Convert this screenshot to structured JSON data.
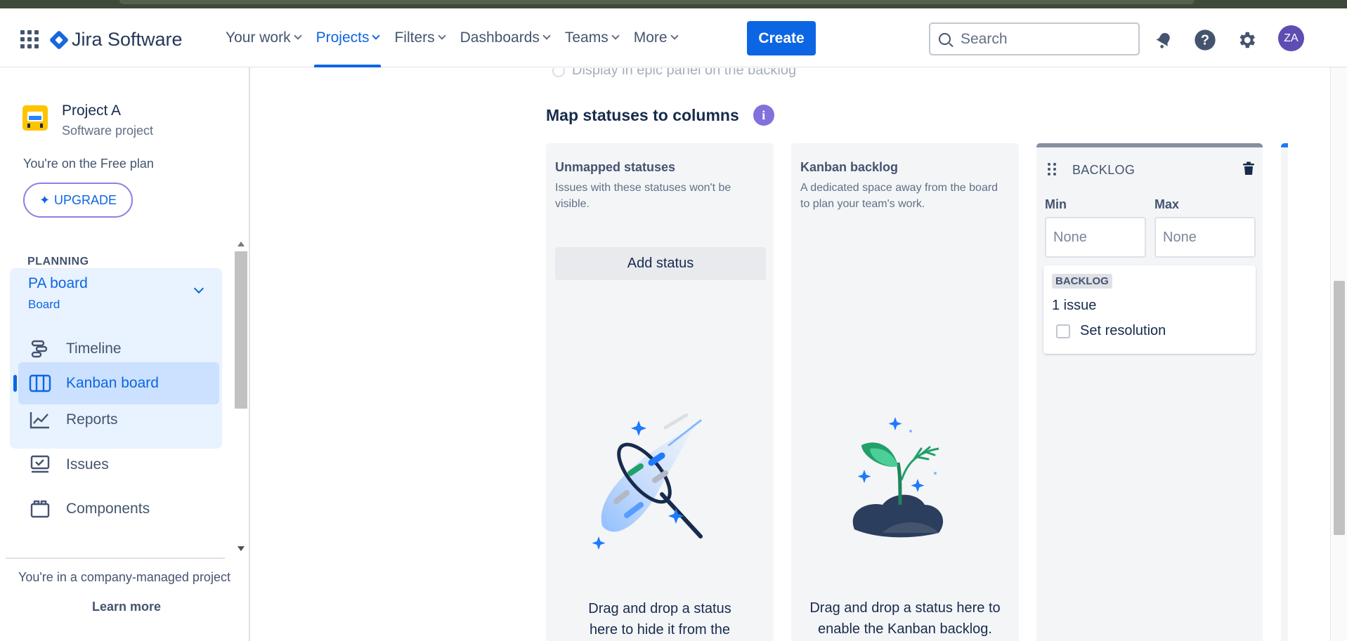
{
  "nav": {
    "brand": "Jira Software",
    "menu": [
      {
        "label": "Your work",
        "active": false
      },
      {
        "label": "Projects",
        "active": true
      },
      {
        "label": "Filters",
        "active": false
      },
      {
        "label": "Dashboards",
        "active": false
      },
      {
        "label": "Teams",
        "active": false
      },
      {
        "label": "More",
        "active": false
      }
    ],
    "create_label": "Create",
    "search_placeholder": "Search",
    "avatar_initials": "ZA",
    "accent_color": "#0c66e4"
  },
  "sidebar": {
    "project_name": "Project A",
    "project_type": "Software project",
    "plan_text": "You're on the Free plan",
    "upgrade_label": "UPGRADE",
    "section_label": "PLANNING",
    "board_name": "PA board",
    "board_sub": "Board",
    "items": [
      {
        "label": "Timeline",
        "icon": "timeline-icon"
      },
      {
        "label": "Kanban board",
        "icon": "kanban-board-icon",
        "selected": true
      },
      {
        "label": "Reports",
        "icon": "reports-icon"
      },
      {
        "label": "Issues",
        "icon": "issues-icon"
      },
      {
        "label": "Components",
        "icon": "components-icon"
      }
    ],
    "footer_text": "You're in a company-managed project",
    "learn_more": "Learn more"
  },
  "main": {
    "faded_option": "Display in epic panel on the backlog",
    "section_title": "Map statuses to columns",
    "unmapped": {
      "title": "Unmapped statuses",
      "desc_line1": "Issues with these statuses won't be",
      "desc_line2": "visible.",
      "add_status": "Add status",
      "dd_line1": "Drag and drop a status",
      "dd_line2": "here to hide it from the"
    },
    "kanban_backlog": {
      "title": "Kanban backlog",
      "desc_line1": "A dedicated space away from the board",
      "desc_line2": "to plan your team's work.",
      "dd_line1": "Drag and drop a status here to",
      "dd_line2": "enable the Kanban backlog."
    },
    "backlog_column": {
      "name": "BACKLOG",
      "min_label": "Min",
      "max_label": "Max",
      "min_placeholder": "None",
      "max_placeholder": "None",
      "status_lozenge": "BACKLOG",
      "issue_count": "1 issue",
      "set_resolution": "Set resolution"
    }
  }
}
